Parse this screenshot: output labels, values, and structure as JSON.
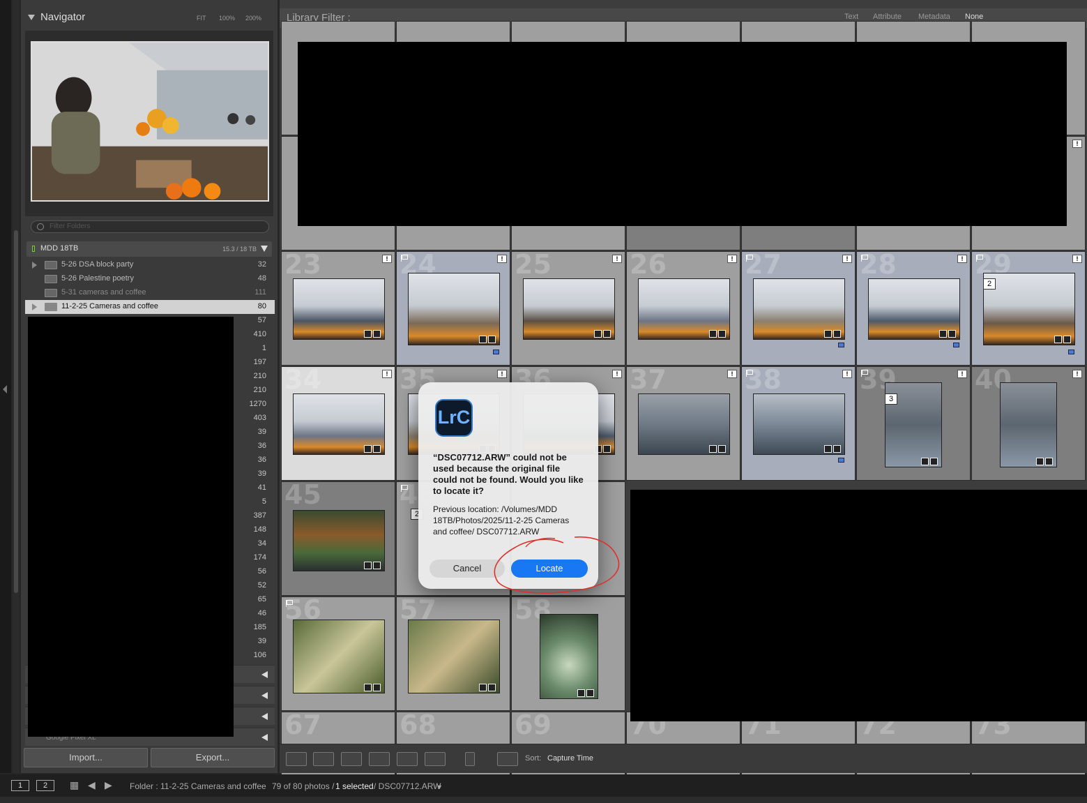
{
  "navigator": {
    "title": "Navigator",
    "zoom_fit": "FIT",
    "zoom_100": "100%",
    "zoom_200": "200%"
  },
  "folders": {
    "search_placeholder": "Filter Folders",
    "volume_name": "MDD 18TB",
    "volume_size": "15.3 / 18 TB",
    "items": [
      {
        "label": "5-26 DSA block party",
        "count": "32"
      },
      {
        "label": "5-26 Palestine poetry",
        "count": "48"
      },
      {
        "label": "5-31 cameras and coffee",
        "count": "111"
      },
      {
        "label": "11-2-25 Cameras and coffee",
        "count": "80"
      }
    ],
    "other_counts": [
      "57",
      "410",
      "1",
      "197",
      "210",
      "210",
      "1270",
      "403",
      "39",
      "36",
      "36",
      "39",
      "41",
      "5",
      "387",
      "148",
      "34",
      "174",
      "56",
      "52",
      "65",
      "46",
      "185",
      "39",
      "106"
    ],
    "last_section_label": "Google Pixel XL"
  },
  "buttons": {
    "import": "Import...",
    "export": "Export..."
  },
  "filter_bar": {
    "title": "Library Filter :",
    "options": [
      "Text",
      "Attribute",
      "Metadata",
      "None"
    ]
  },
  "grid": {
    "row3_numbers": [
      "23",
      "24",
      "25",
      "26",
      "27",
      "28",
      "29"
    ],
    "row4_numbers": [
      "34",
      "35",
      "36",
      "37",
      "38",
      "39",
      "40"
    ],
    "row5_numbers": [
      "45",
      "46"
    ],
    "row6_numbers": [
      "56",
      "57",
      "58"
    ],
    "row7_numbers": [
      "67",
      "68",
      "69",
      "70",
      "71",
      "72",
      "73"
    ],
    "stack_labels": {
      "c29": "2",
      "c39": "3",
      "c46": "2"
    }
  },
  "toolbar": {
    "sort_label": "Sort:",
    "sort_value": "Capture Time"
  },
  "status": {
    "monitor1": "1",
    "monitor2": "2",
    "folder_text": "Folder : 11-2-25 Cameras and coffee",
    "count_text": "79 of 80 photos /",
    "selected_text": "1 selected",
    "file_text": "/ DSC07712.ARW"
  },
  "dialog": {
    "app_icon_text": "LrC",
    "message": "“DSC07712.ARW” could not be used because the original file could not be found. Would you like to locate it?",
    "info": "Previous location: /Volumes/MDD 18TB/Photos/2025/11-2-25 Cameras and coffee/ DSC07712.ARW",
    "cancel_label": "Cancel",
    "locate_label": "Locate"
  },
  "colors": {
    "accent_blue": "#1877f2",
    "annotation_red": "#e0302a"
  }
}
